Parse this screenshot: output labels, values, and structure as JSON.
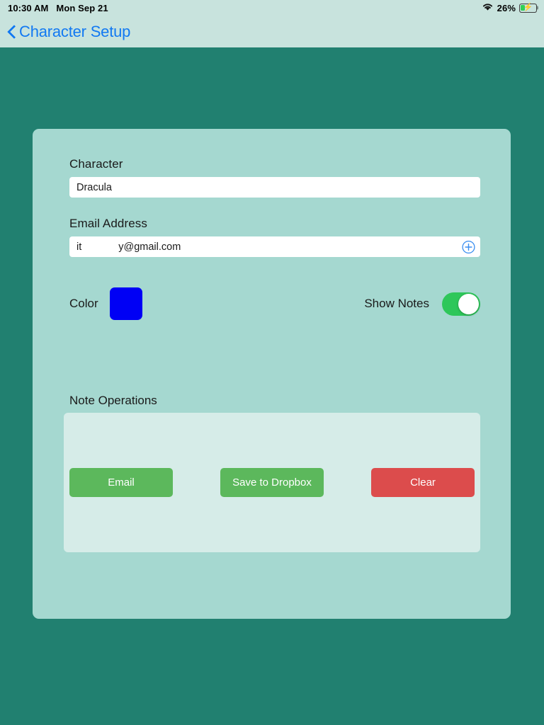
{
  "status_bar": {
    "time": "10:30 AM",
    "date": "Mon Sep 21",
    "wifi_icon": "wifi-icon",
    "battery_percent": "26%",
    "battery_level": 26,
    "battery_charging": true
  },
  "nav_bar": {
    "back_icon": "chevron-left-icon",
    "title": "Character Setup"
  },
  "form": {
    "character": {
      "label": "Character",
      "value": "Dracula",
      "placeholder": "Character"
    },
    "email": {
      "label": "Email Address",
      "value_prefix": "it",
      "value_suffix": "y@gmail.com",
      "placeholder": "Email Address",
      "add_icon": "plus-circle-icon"
    },
    "color": {
      "label": "Color",
      "value": "#0000F5"
    },
    "show_notes": {
      "label": "Show Notes",
      "enabled": true,
      "on_color": "#2EC75A"
    }
  },
  "note_operations": {
    "title": "Note Operations",
    "buttons": [
      {
        "label": "Email",
        "color": "#5CB85C"
      },
      {
        "label": "Save to Dropbox",
        "color": "#5CB85C"
      },
      {
        "label": "Clear",
        "color": "#DC4C4C"
      }
    ]
  },
  "theme": {
    "background": "#218070",
    "card": "#A5D8D0",
    "bar": "#C8E3DD",
    "panel": "#D6ECE8",
    "accent": "#1279F2"
  }
}
